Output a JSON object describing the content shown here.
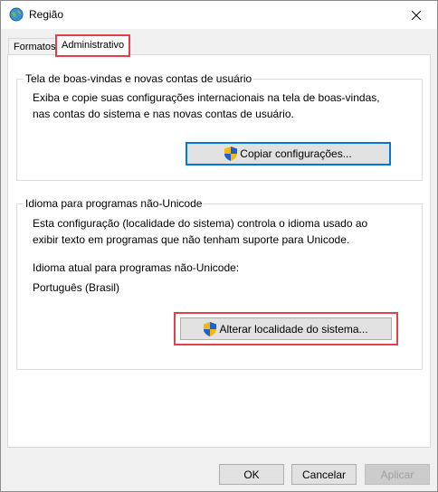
{
  "window": {
    "title": "Região",
    "icon": "globe-icon",
    "close_icon": "close-icon"
  },
  "tabs": [
    {
      "label": "Formatos"
    },
    {
      "label": "Administrativo",
      "selected": true
    }
  ],
  "welcome_group": {
    "legend": "Tela de boas-vindas e novas contas de usuário",
    "line1": "Exiba e copie suas configurações internacionais na tela de boas-vindas,",
    "line2": "nas contas do sistema e nas novas contas de usuário.",
    "button_label": "Copiar configurações...",
    "button_icon": "uac-shield-icon"
  },
  "unicode_group": {
    "legend": "Idioma para programas não-Unicode",
    "line1": "Esta configuração (localidade do sistema) controla o idioma usado ao",
    "line2": "exibir texto em programas que não tenham suporte para Unicode.",
    "current_label": "Idioma atual para programas não-Unicode:",
    "current_value": "Português (Brasil)",
    "button_label": "Alterar localidade do sistema...",
    "button_icon": "uac-shield-icon"
  },
  "footer": {
    "ok": "OK",
    "cancel": "Cancelar",
    "apply": "Aplicar"
  },
  "colors": {
    "highlight": "#e0404a",
    "focus": "#0078d7"
  }
}
